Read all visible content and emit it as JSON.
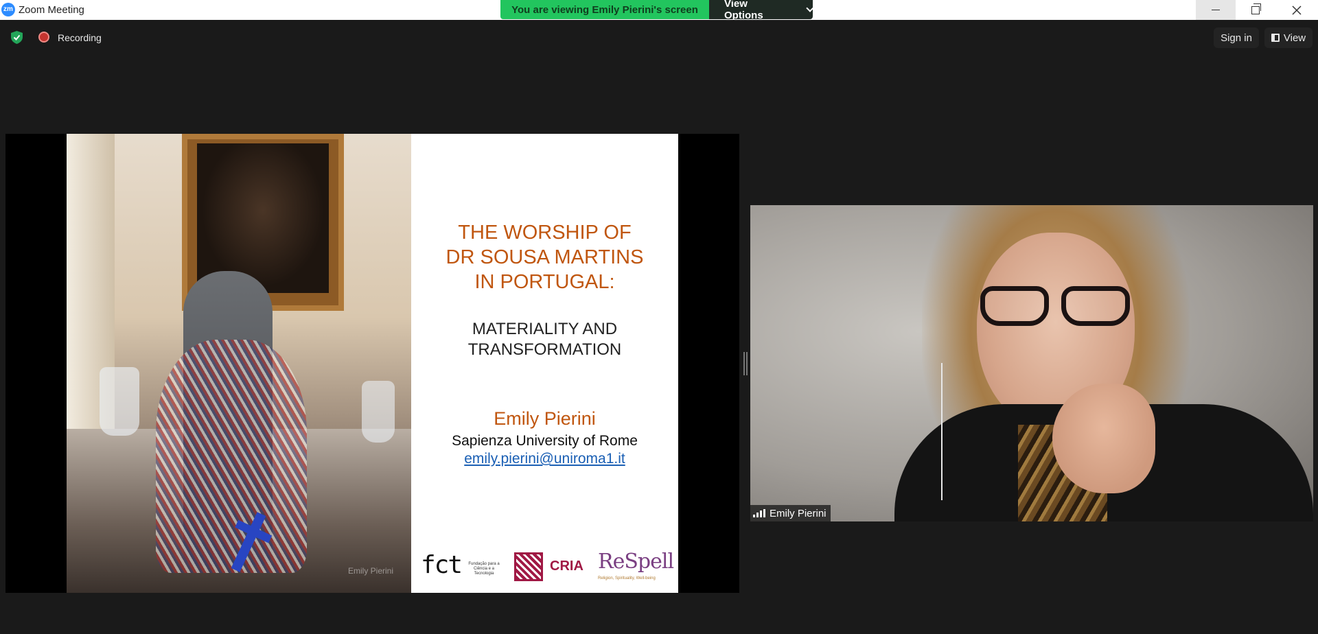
{
  "window": {
    "app_logo": "zm",
    "title": "Zoom Meeting",
    "minimize_icon": "minimize-icon",
    "maximize_icon": "restore-icon",
    "close_icon": "close-icon"
  },
  "share_banner": {
    "viewing_text": "You are viewing Emily Pierini's screen",
    "options_label": "View Options"
  },
  "topbar": {
    "security_icon": "shield-check-icon",
    "recording_label": "Recording",
    "sign_in_label": "Sign in",
    "view_label": "View"
  },
  "slide": {
    "title_lines": [
      "THE WORSHIP OF",
      "DR SOUSA MARTINS",
      "IN PORTUGAL:"
    ],
    "subtitle_lines": [
      "MATERIALITY AND",
      "TRANSFORMATION"
    ],
    "author": "Emily Pierini",
    "affiliation": "Sapienza University of Rome",
    "email": "emily.pierini@uniroma1.it",
    "watermark": "Emily Pierini",
    "logos": {
      "fct": "fct",
      "fct_text": "Fundação para a Ciência e a Tecnologia",
      "cria": "CRIA",
      "respell": "ReSpell",
      "respell_sub": "Religion, Spirituality, Well-being"
    }
  },
  "participant": {
    "name": "Emily Pierini"
  },
  "colors": {
    "background": "#1a1a1a",
    "banner_green": "#22c55e",
    "slide_title": "#c0560f",
    "email_link": "#1a5fb4",
    "recording_red": "#c4342f"
  }
}
